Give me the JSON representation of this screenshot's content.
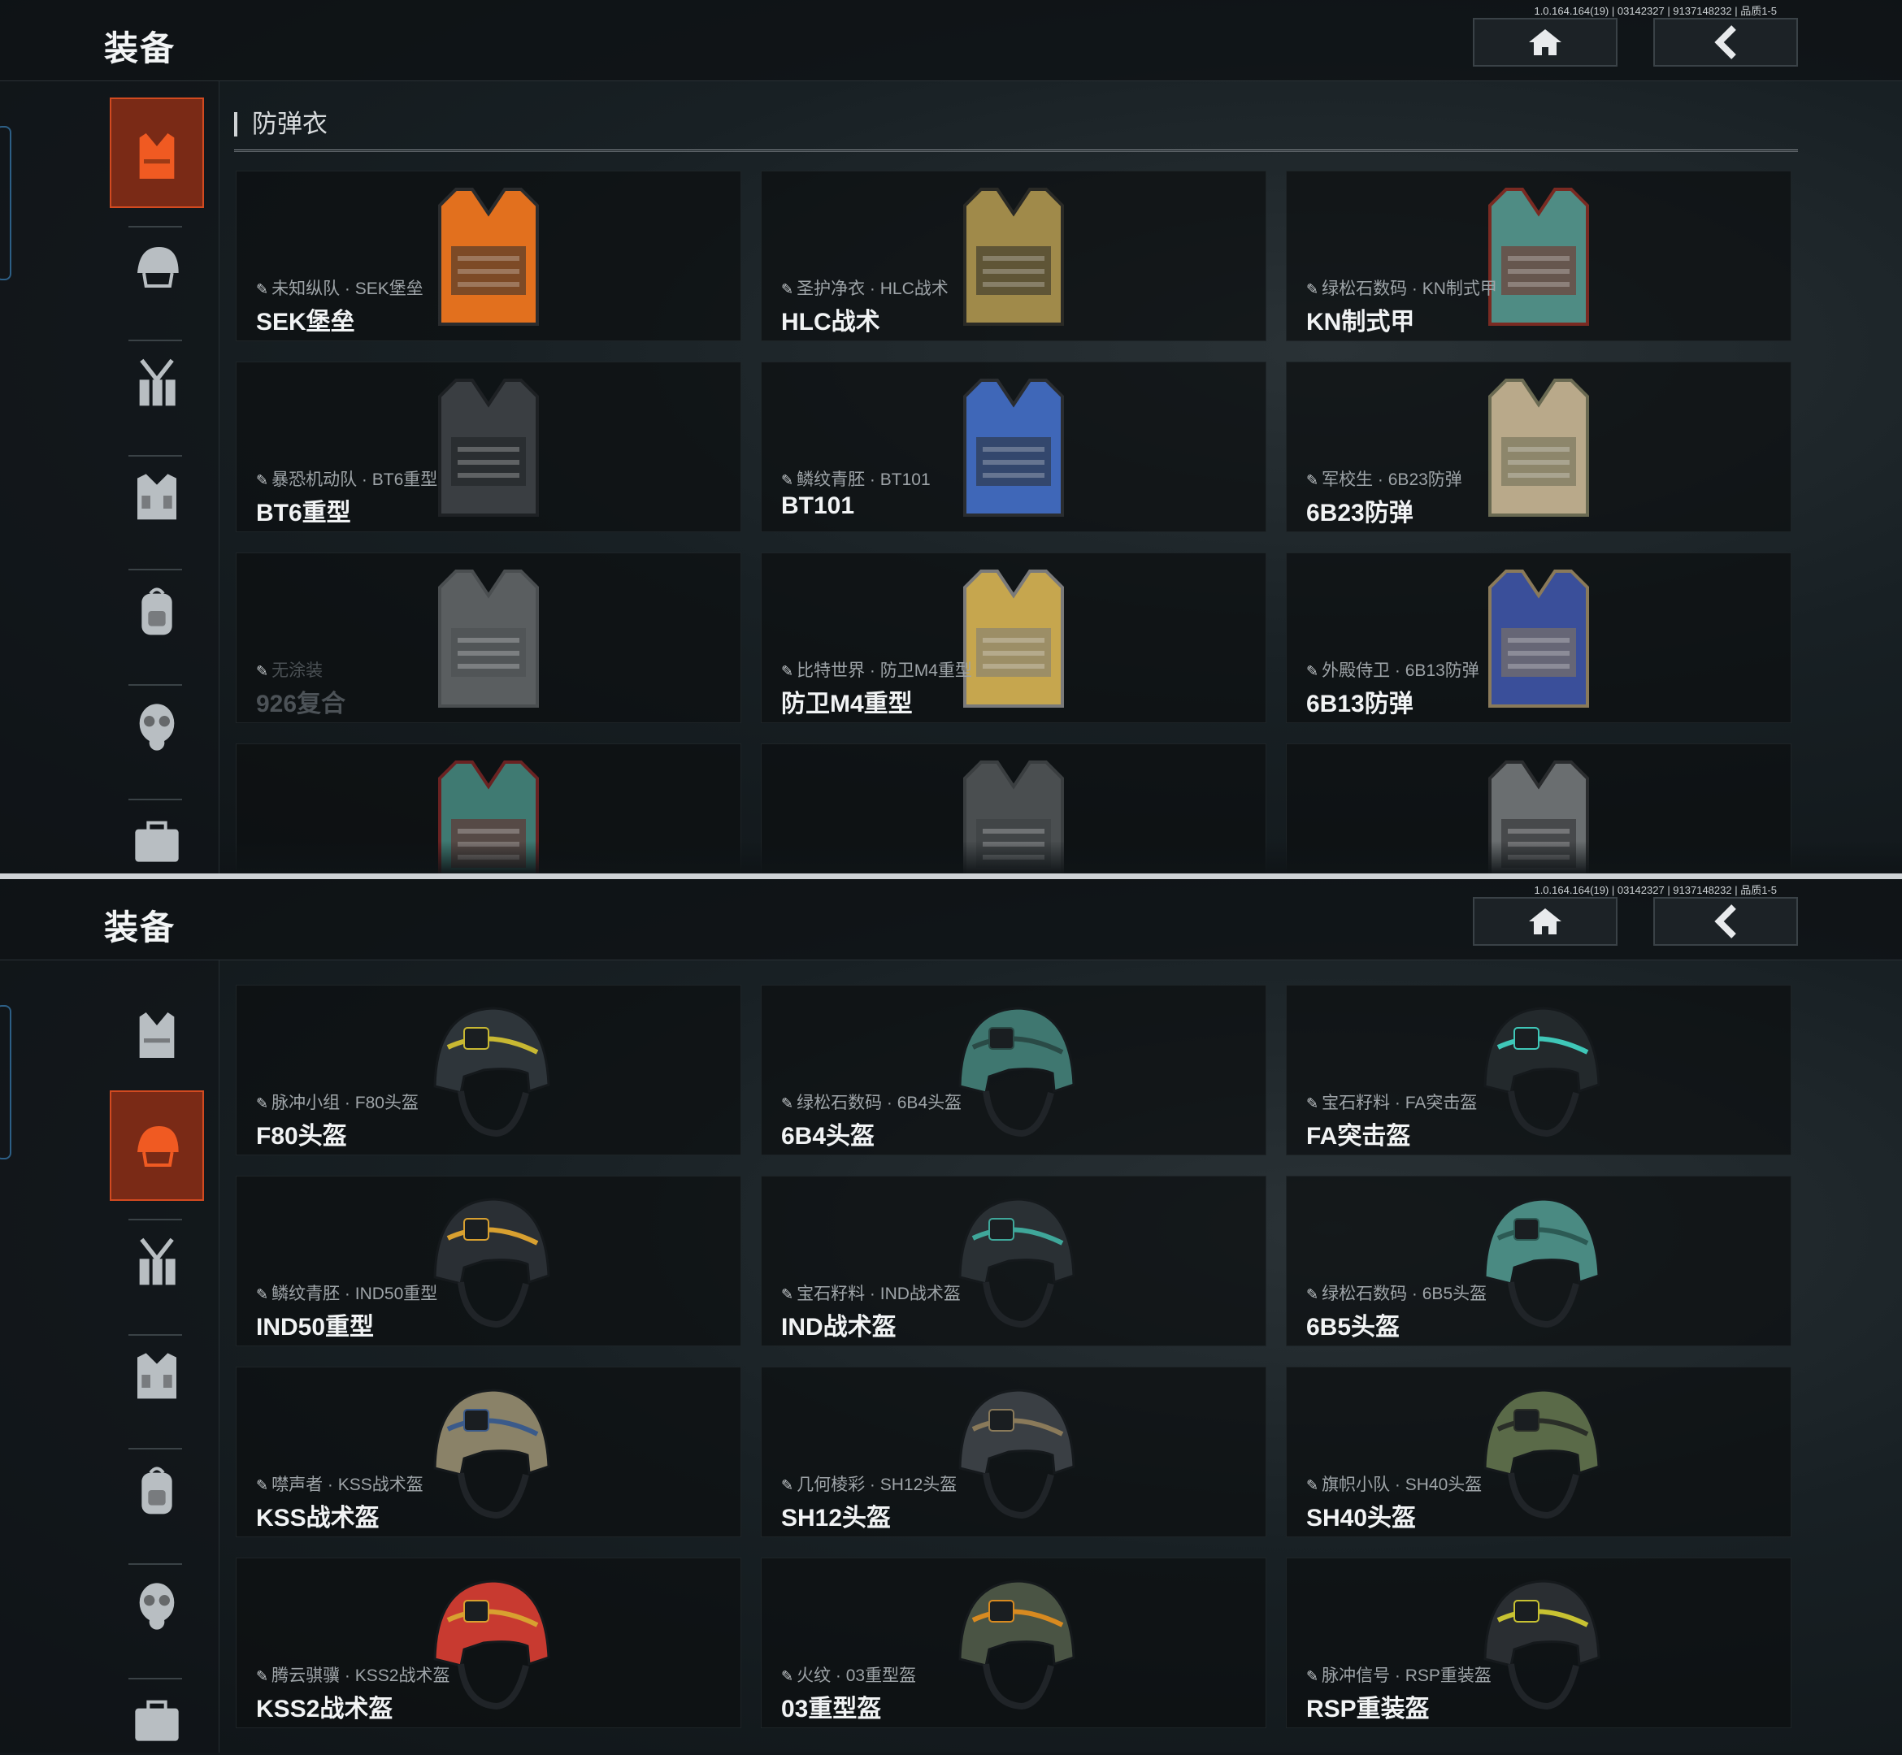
{
  "version": "1.0.164.164(19) | 03142327 | 9137148232 | 品质1-5",
  "title": "装备",
  "colors": {
    "accent": "#d24a20",
    "active_bg": "#7a2a16"
  },
  "header_buttons": [
    {
      "name": "home-button",
      "icon": "home-icon"
    },
    {
      "name": "back-button",
      "icon": "chevron-left-icon"
    }
  ],
  "sidebar_icons": [
    "vest-icon",
    "helmet-icon",
    "chest-rig-icon",
    "tactical-vest-icon",
    "backpack-icon",
    "gas-mask-icon",
    "case-icon"
  ],
  "screen1": {
    "active_category": "vest-icon",
    "section_title": "防弹衣",
    "cards": [
      {
        "sub": "未知纵队 · SEK堡垒",
        "name": "SEK堡垒",
        "main": "#e2701e",
        "trim": "#2a2c2e",
        "shape": "vest"
      },
      {
        "sub": "圣护净衣 · HLC战术",
        "name": "HLC战术",
        "main": "#a08a4a",
        "trim": "#2a2a26",
        "shape": "vest"
      },
      {
        "sub": "绿松石数码 · KN制式甲",
        "name": "KN制式甲",
        "main": "#4f8c84",
        "trim": "#7a2a22",
        "shape": "vest"
      },
      {
        "sub": "暴恐机动队 · BT6重型",
        "name": "BT6重型",
        "main": "#3a3e42",
        "trim": "#1e2124",
        "shape": "vest"
      },
      {
        "sub": "鳞纹青胚 · BT101",
        "name": "BT101",
        "main": "#3f67b8",
        "trim": "#2a2d30",
        "shape": "vest"
      },
      {
        "sub": "军校生 · 6B23防弹",
        "name": "6B23防弹",
        "main": "#b9a98a",
        "trim": "#6a6a52",
        "shape": "vest"
      },
      {
        "sub": "无涂装",
        "name": "926复合",
        "main": "#5a5e60",
        "trim": "#4a4e50",
        "shape": "vest",
        "dim": true
      },
      {
        "sub": "比特世界 · 防卫M4重型",
        "name": "防卫M4重型",
        "main": "#c6a64e",
        "trim": "#7a7a7a",
        "shape": "vest"
      },
      {
        "sub": "外殿侍卫 · 6B13防弹",
        "name": "6B13防弹",
        "main": "#3a4f9a",
        "trim": "#8a7a5a",
        "shape": "vest"
      },
      {
        "sub": "",
        "name": "",
        "main": "#3f7a72",
        "trim": "#6a2222",
        "shape": "vest"
      },
      {
        "sub": "",
        "name": "",
        "main": "#4a4e50",
        "trim": "#3a3e40",
        "shape": "vest"
      },
      {
        "sub": "",
        "name": "",
        "main": "#6a6e70",
        "trim": "#2a2c2e",
        "shape": "vest"
      }
    ]
  },
  "screen2": {
    "active_category": "helmet-icon",
    "cards": [
      {
        "sub": "脉冲小组 · F80头盔",
        "name": "F80头盔",
        "main": "#2e353a",
        "trim": "#c8b832",
        "shape": "helmet"
      },
      {
        "sub": "绿松石数码 · 6B4头盔",
        "name": "6B4头盔",
        "main": "#3f7770",
        "trim": "#2a4a46",
        "shape": "helmet"
      },
      {
        "sub": "宝石籽料 · FA突击盔",
        "name": "FA突击盔",
        "main": "#23292c",
        "trim": "#3fc7b8",
        "shape": "helmet"
      },
      {
        "sub": "鳞纹青胚 · IND50重型",
        "name": "IND50重型",
        "main": "#2a2f34",
        "trim": "#d8a030",
        "shape": "helmet"
      },
      {
        "sub": "宝石籽料 · IND战术盔",
        "name": "IND战术盔",
        "main": "#2a3034",
        "trim": "#3fa79a",
        "shape": "helmet"
      },
      {
        "sub": "绿松石数码 · 6B5头盔",
        "name": "6B5头盔",
        "main": "#4a8a82",
        "trim": "#2c5a54",
        "shape": "helmet"
      },
      {
        "sub": "噤声者 · KSS战术盔",
        "name": "KSS战术盔",
        "main": "#8a8268",
        "trim": "#3a5a8a",
        "shape": "helmet"
      },
      {
        "sub": "几何棱彩 · SH12头盔",
        "name": "SH12头盔",
        "main": "#3a3f44",
        "trim": "#8a7a5a",
        "shape": "helmet"
      },
      {
        "sub": "旗帜小队 · SH40头盔",
        "name": "SH40头盔",
        "main": "#5a6a48",
        "trim": "#2a2e28",
        "shape": "helmet"
      },
      {
        "sub": "腾云骐骥 · KSS2战术盔",
        "name": "KSS2战术盔",
        "main": "#c83a30",
        "trim": "#d8a030",
        "shape": "helmet"
      },
      {
        "sub": "火纹 · 03重型盔",
        "name": "03重型盔",
        "main": "#4a5444",
        "trim": "#d88a20",
        "shape": "helmet"
      },
      {
        "sub": "脉冲信号 · RSP重装盔",
        "name": "RSP重装盔",
        "main": "#2a2e32",
        "trim": "#c8c232",
        "shape": "helmet"
      }
    ]
  }
}
